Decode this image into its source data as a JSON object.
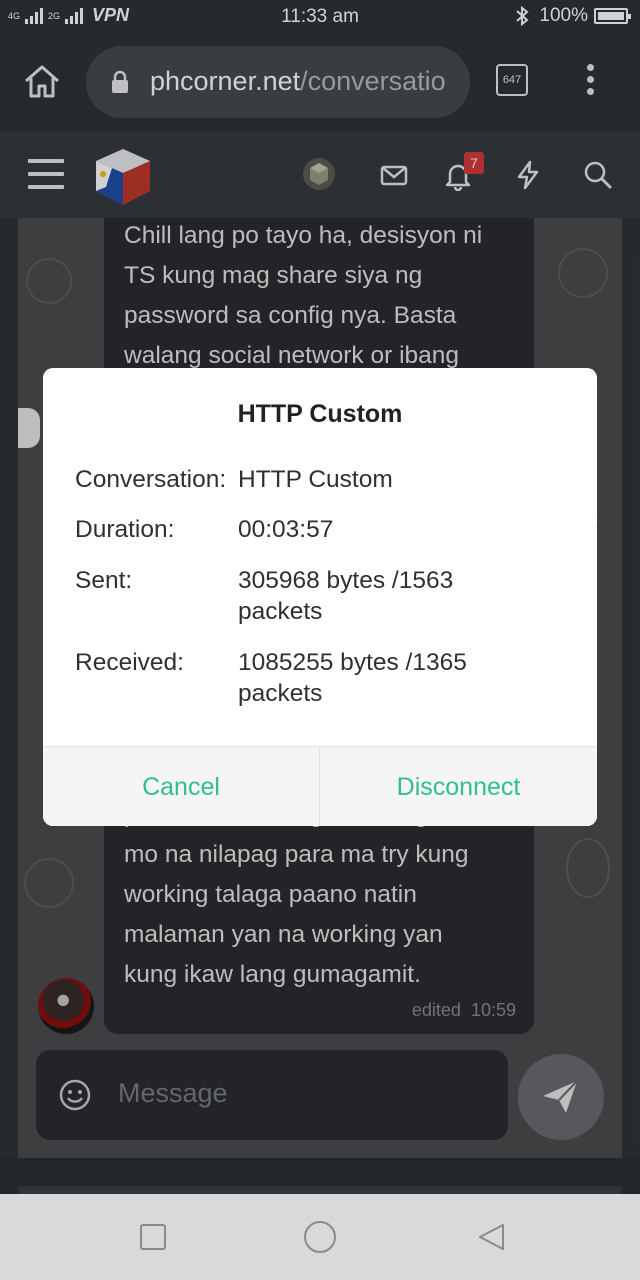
{
  "status_bar": {
    "network_top": "4G",
    "network_bottom": "2G",
    "vpn": "VPN",
    "time": "11:33 am",
    "battery": "100%"
  },
  "browser": {
    "url_host": "phcorner.net",
    "url_path": "/conversatio",
    "tab_count": "647"
  },
  "site_header": {
    "notification_count": "7"
  },
  "chat": {
    "top_message_lines": [
      "Chill lang po tayo ha, desisyon ni",
      "TS kung mag share siya ng",
      "password sa config nya. Basta",
      "walang social network or ibang"
    ],
    "bottom_message_lines": [
      "password mo lang sa config ui",
      "mo na nilapag para ma try kung",
      "working talaga paano natin",
      "malaman yan na working yan",
      "kung ikaw lang gumagamit."
    ],
    "edited_label": "edited",
    "edited_time": "10:59",
    "composer_placeholder": "Message"
  },
  "dialog": {
    "title": "HTTP Custom",
    "rows": [
      {
        "label": "Conversation:",
        "value": "HTTP Custom"
      },
      {
        "label": "Duration:",
        "value": "00:03:57"
      },
      {
        "label": "Sent:",
        "value": "305968 bytes /1563 packets"
      },
      {
        "label": "Received:",
        "value": "1085255 bytes /1365 packets"
      }
    ],
    "cancel_label": "Cancel",
    "disconnect_label": "Disconnect"
  },
  "colors": {
    "accent": "#2fbf8f",
    "badge": "#d63b3b",
    "bubble": "#2b2d31"
  },
  "icons": [
    "signal-icon",
    "bluetooth-icon",
    "battery-icon",
    "home-icon",
    "lock-icon",
    "tabs-icon",
    "kebab-menu-icon",
    "hamburger-icon",
    "logo-icon",
    "avatar-icon",
    "mail-icon",
    "bell-icon",
    "bolt-icon",
    "search-icon",
    "emoji-icon",
    "send-icon",
    "recents-icon",
    "home-circle-icon",
    "back-icon"
  ]
}
